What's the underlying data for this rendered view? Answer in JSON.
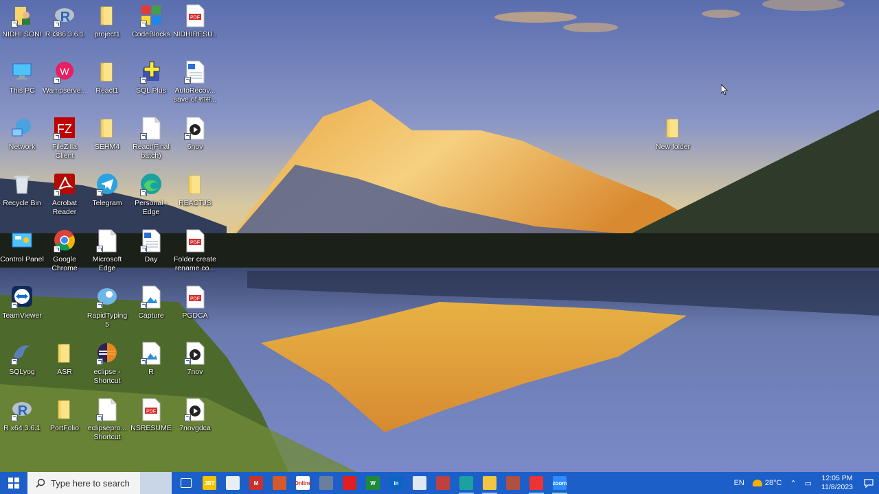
{
  "desktop": {
    "icons": [
      {
        "label": "NIDHI SONI",
        "kind": "user-folder-icon"
      },
      {
        "label": "R i386 3.6.1",
        "kind": "r-icon"
      },
      {
        "label": "project1",
        "kind": "folder-icon"
      },
      {
        "label": "CodeBlocks",
        "kind": "codeblocks-icon"
      },
      {
        "label": "NIDHIRESU...",
        "kind": "pdf-icon"
      },
      {
        "label": "This PC",
        "kind": "pc-icon"
      },
      {
        "label": "Wampserve...",
        "kind": "wamp-icon"
      },
      {
        "label": "React1",
        "kind": "folder-icon"
      },
      {
        "label": "SQL Plus",
        "kind": "sqlplus-icon"
      },
      {
        "label": "AutoRecov...\nsave of शास...",
        "kind": "doc-icon"
      },
      {
        "label": "Network",
        "kind": "network-icon"
      },
      {
        "label": "FileZilla\nClient",
        "kind": "filezilla-icon"
      },
      {
        "label": "SEHM4",
        "kind": "folder-icon"
      },
      {
        "label": "React(Final\nbatch)",
        "kind": "file-icon"
      },
      {
        "label": "6nov",
        "kind": "video-icon"
      },
      {
        "label": "New folder",
        "kind": "folder-icon"
      },
      {
        "label": "Recycle Bin",
        "kind": "recycle-bin-icon"
      },
      {
        "label": "Acrobat\nReader",
        "kind": "acrobat-icon"
      },
      {
        "label": "Telegram",
        "kind": "telegram-icon"
      },
      {
        "label": "Personal -\nEdge",
        "kind": "edge-icon"
      },
      {
        "label": "REACTJS",
        "kind": "folder-zip-icon"
      },
      {
        "label": "Control Panel",
        "kind": "control-panel-icon"
      },
      {
        "label": "Google\nChrome",
        "kind": "chrome-icon"
      },
      {
        "label": "Microsoft\nEdge",
        "kind": "file-icon"
      },
      {
        "label": "Day",
        "kind": "doc-icon"
      },
      {
        "label": "Folder create\nrename co...",
        "kind": "pdf-icon"
      },
      {
        "label": "TeamViewer",
        "kind": "teamviewer-icon"
      },
      {
        "label": "RapidTyping\n5",
        "kind": "rapidtyping-icon"
      },
      {
        "label": "Capture",
        "kind": "image-icon"
      },
      {
        "label": "PGDCA",
        "kind": "pdf-icon"
      },
      {
        "label": "SQLyog",
        "kind": "sqlyog-icon"
      },
      {
        "label": "ASR",
        "kind": "folder-icon"
      },
      {
        "label": "eclipse -\nShortcut",
        "kind": "eclipse-icon"
      },
      {
        "label": "R",
        "kind": "image-icon"
      },
      {
        "label": "7nov",
        "kind": "video-icon"
      },
      {
        "label": "R x64 3.6.1",
        "kind": "r-icon"
      },
      {
        "label": "PortFolio",
        "kind": "folder-icon"
      },
      {
        "label": "eclipsepro...\nShortcut",
        "kind": "file-icon"
      },
      {
        "label": "NSRESUME",
        "kind": "pdf-icon"
      },
      {
        "label": "7novgdca",
        "kind": "video-icon"
      }
    ]
  },
  "taskbar": {
    "search_placeholder": "Type here to search",
    "apps": [
      {
        "name": "task-view-icon",
        "text": "",
        "color": "#1c5fc8"
      },
      {
        "name": "jbt-app-icon",
        "text": "JBT",
        "color": "#f5c400"
      },
      {
        "name": "app2-icon",
        "text": "",
        "color": "#e9eef5"
      },
      {
        "name": "app3-icon",
        "text": "M",
        "color": "#c8322e"
      },
      {
        "name": "app4-icon",
        "text": "",
        "color": "#d35a2a"
      },
      {
        "name": "online-app-icon",
        "text": "Online",
        "color": "#ffffff"
      },
      {
        "name": "app6-icon",
        "text": "",
        "color": "#6a7fa0"
      },
      {
        "name": "app7-icon",
        "text": "",
        "color": "#e02020"
      },
      {
        "name": "app8-icon",
        "text": "W",
        "color": "#1e8a3a"
      },
      {
        "name": "linkedin-icon",
        "text": "in",
        "color": "#0a66c2"
      },
      {
        "name": "app10-icon",
        "text": "",
        "color": "#dfe7f2"
      },
      {
        "name": "app11-icon",
        "text": "",
        "color": "#c04040"
      },
      {
        "name": "edge-taskbar-icon",
        "text": "",
        "color": "#1ba1a0"
      },
      {
        "name": "file-explorer-icon",
        "text": "",
        "color": "#f4c542"
      },
      {
        "name": "app14-icon",
        "text": "",
        "color": "#b05040"
      },
      {
        "name": "acrobat-taskbar-icon",
        "text": "",
        "color": "#e33"
      },
      {
        "name": "zoom-icon",
        "text": "zoom",
        "color": "#2d8cff"
      }
    ],
    "language": "EN",
    "weather": "28°C",
    "time": "12:05 PM",
    "date": "11/8/2023"
  }
}
